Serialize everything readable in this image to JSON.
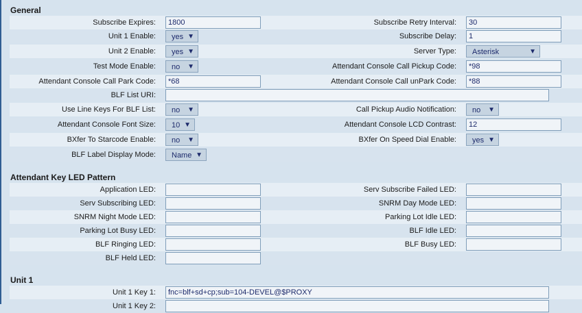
{
  "sections": {
    "general": "General",
    "led": "Attendant Key LED Pattern",
    "unit1": "Unit 1"
  },
  "general": {
    "subscribe_expires": {
      "label": "Subscribe Expires:",
      "value": "1800"
    },
    "subscribe_retry": {
      "label": "Subscribe Retry Interval:",
      "value": "30"
    },
    "unit1_enable": {
      "label": "Unit 1 Enable:",
      "value": "yes"
    },
    "subscribe_delay": {
      "label": "Subscribe Delay:",
      "value": "1"
    },
    "unit2_enable": {
      "label": "Unit 2 Enable:",
      "value": "yes"
    },
    "server_type": {
      "label": "Server Type:",
      "value": "Asterisk"
    },
    "test_mode": {
      "label": "Test Mode Enable:",
      "value": "no"
    },
    "pickup_code": {
      "label": "Attendant Console Call Pickup Code:",
      "value": "*98"
    },
    "park_code": {
      "label": "Attendant Console Call Park Code:",
      "value": "*68"
    },
    "unpark_code": {
      "label": "Attendant Console Call unPark Code:",
      "value": "*88"
    },
    "blf_list_uri": {
      "label": "BLF List URI:",
      "value": ""
    },
    "line_keys_blf": {
      "label": "Use Line Keys For BLF List:",
      "value": "no"
    },
    "pickup_audio": {
      "label": "Call Pickup Audio Notification:",
      "value": "no"
    },
    "font_size": {
      "label": "Attendant Console Font Size:",
      "value": "10"
    },
    "lcd_contrast": {
      "label": "Attendant Console LCD Contrast:",
      "value": "12"
    },
    "bxfer_starcode": {
      "label": "BXfer To Starcode Enable:",
      "value": "no"
    },
    "bxfer_speed_dial": {
      "label": "BXfer On Speed Dial Enable:",
      "value": "yes"
    },
    "blf_label_mode": {
      "label": "BLF Label Display Mode:",
      "value": "Name"
    }
  },
  "led": {
    "application": {
      "label": "Application LED:",
      "value": ""
    },
    "serv_sub_failed": {
      "label": "Serv Subscribe Failed LED:",
      "value": ""
    },
    "serv_subscribing": {
      "label": "Serv Subscribing LED:",
      "value": ""
    },
    "snrm_day": {
      "label": "SNRM Day Mode LED:",
      "value": ""
    },
    "snrm_night": {
      "label": "SNRM Night Mode LED:",
      "value": ""
    },
    "parking_idle": {
      "label": "Parking Lot Idle LED:",
      "value": ""
    },
    "parking_busy": {
      "label": "Parking Lot Busy LED:",
      "value": ""
    },
    "blf_idle": {
      "label": "BLF Idle LED:",
      "value": ""
    },
    "blf_ringing": {
      "label": "BLF Ringing LED:",
      "value": ""
    },
    "blf_busy": {
      "label": "BLF Busy LED:",
      "value": ""
    },
    "blf_held": {
      "label": "BLF Held LED:",
      "value": ""
    }
  },
  "unit1": {
    "key1": {
      "label": "Unit 1 Key 1:",
      "value": "fnc=blf+sd+cp;sub=104-DEVEL@$PROXY"
    },
    "key2": {
      "label": "Unit 1 Key 2:",
      "value": ""
    }
  },
  "icons": {
    "dropdown": "▼"
  }
}
